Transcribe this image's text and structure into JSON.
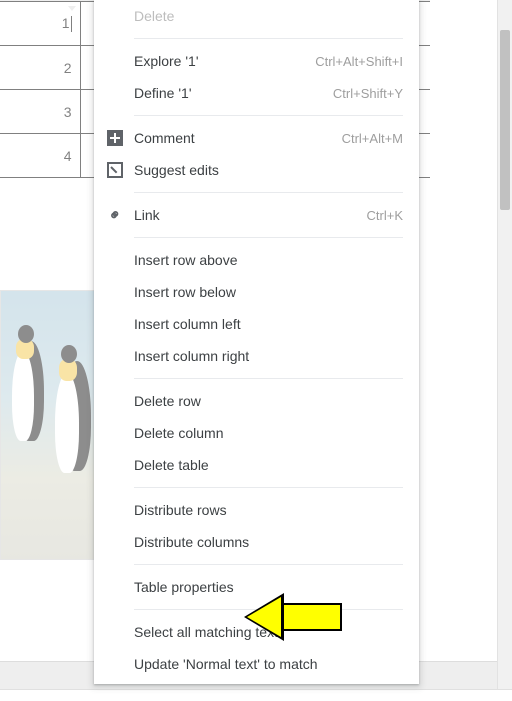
{
  "table": {
    "rows": [
      "1",
      "2",
      "3",
      "4"
    ]
  },
  "menu": {
    "delete": "Delete",
    "explore": {
      "label": "Explore '1'",
      "shortcut": "Ctrl+Alt+Shift+I"
    },
    "define": {
      "label": "Define '1'",
      "shortcut": "Ctrl+Shift+Y"
    },
    "comment": {
      "label": "Comment",
      "shortcut": "Ctrl+Alt+M"
    },
    "suggest": "Suggest edits",
    "link": {
      "label": "Link",
      "shortcut": "Ctrl+K"
    },
    "insert_row_above": "Insert row above",
    "insert_row_below": "Insert row below",
    "insert_col_left": "Insert column left",
    "insert_col_right": "Insert column right",
    "delete_row": "Delete row",
    "delete_col": "Delete column",
    "delete_table": "Delete table",
    "distribute_rows": "Distribute rows",
    "distribute_columns": "Distribute columns",
    "table_properties": "Table properties",
    "select_matching": "Select all matching text",
    "update_normal": "Update 'Normal text' to match"
  }
}
